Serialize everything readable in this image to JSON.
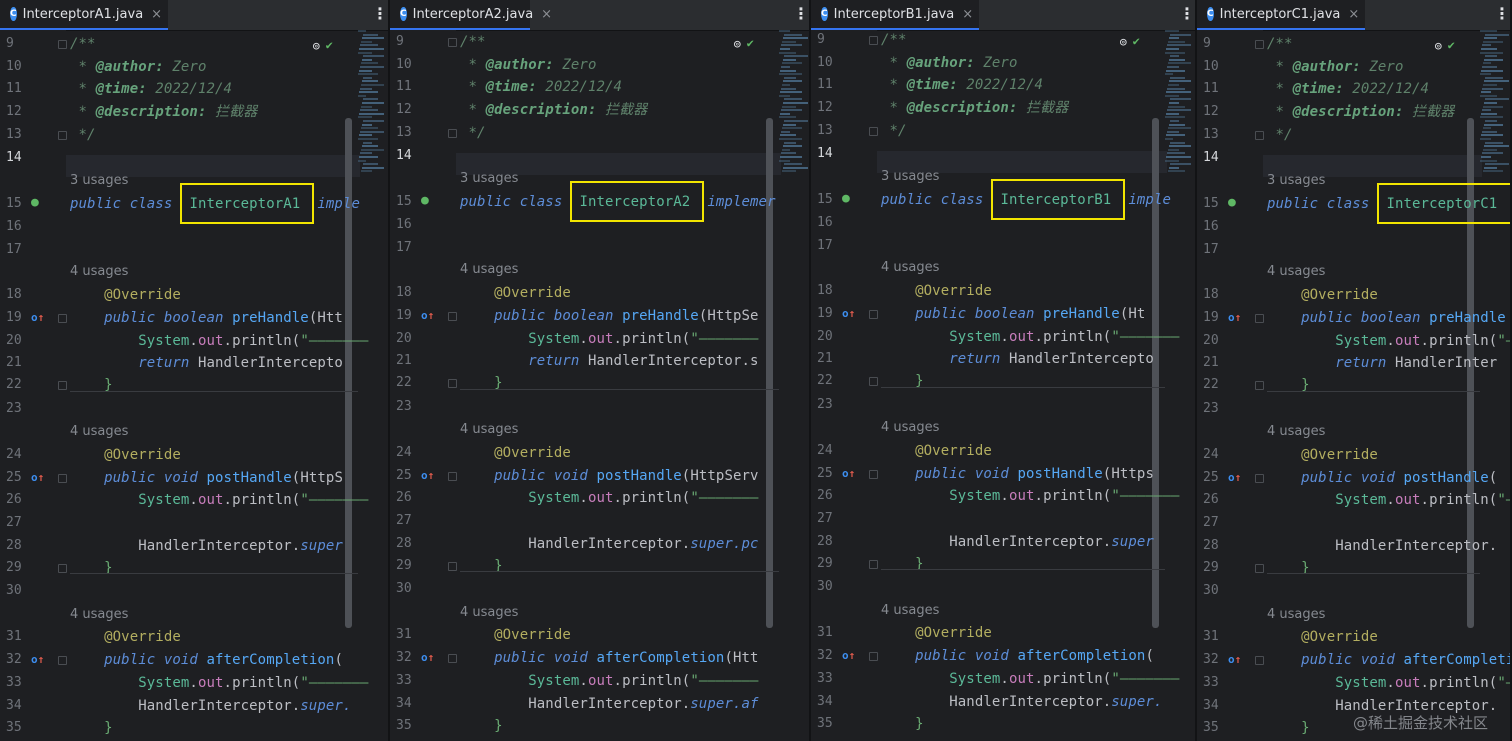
{
  "panes": [
    {
      "tab": "InterceptorA1.java",
      "class_name": "InterceptorA1",
      "after_class": " imple",
      "pre_tail": "(Htt",
      "ret_tail": "HandlerIntercepto",
      "post_tail": "(HttpS",
      "super_post": "HandlerInterceptor.super",
      "after_tail": "(",
      "super_after": "HandlerInterceptor.super."
    },
    {
      "tab": "InterceptorA2.java",
      "class_name": "InterceptorA2",
      "after_class": " implemer",
      "pre_tail": "(HttpSe",
      "ret_tail": "HandlerInterceptor.s",
      "post_tail": "(HttpServ",
      "super_post": "HandlerInterceptor.super.pc",
      "after_tail": "(Htt",
      "super_after": "HandlerInterceptor.super.af"
    },
    {
      "tab": "InterceptorB1.java",
      "class_name": "InterceptorB1",
      "after_class": " imple",
      "pre_tail": "(Ht",
      "ret_tail": "HandlerIntercepto",
      "post_tail": "(Https",
      "super_post": "HandlerInterceptor.super",
      "after_tail": "(",
      "super_after": "HandlerInterceptor.super."
    },
    {
      "tab": "InterceptorC1.java",
      "class_name": "InterceptorC1",
      "after_class": "",
      "pre_tail": "",
      "ret_tail": "HandlerInter",
      "post_tail": "(",
      "super_post": "HandlerInterceptor.",
      "after_tail": "",
      "super_after": "HandlerInterceptor."
    }
  ],
  "common": {
    "doc_open": "/**",
    "doc_close": "*/",
    "author_tag": "@author:",
    "author_val": " Zero",
    "time_tag": "@time:",
    "time_val": " 2022/12/4",
    "desc_tag": "@description:",
    "desc_val": " 拦截器",
    "usages_3": "3 usages",
    "usages_4": "4 usages",
    "kw_public": "public",
    "kw_class": "class",
    "kw_boolean": "boolean",
    "kw_void": "void",
    "kw_return": "return",
    "override": "@Override",
    "m_pre": "preHandle",
    "m_post": "postHandle",
    "m_after": "afterCompletion",
    "system": "System",
    "out": "out",
    "println": ".println(",
    "str_dash": "\"———————",
    "brace_close": "}",
    "line_numbers": [
      "9",
      "10",
      "11",
      "12",
      "13",
      "14",
      "15",
      "16",
      "17",
      "18",
      "19",
      "20",
      "21",
      "22",
      "23",
      "24",
      "25",
      "26",
      "27",
      "28",
      "29",
      "30",
      "31",
      "32",
      "33",
      "34",
      "35"
    ]
  },
  "watermark": "@稀土掘金技术社区",
  "colors": {
    "highlight_box": "#f2e500",
    "accent": "#3574f0"
  }
}
